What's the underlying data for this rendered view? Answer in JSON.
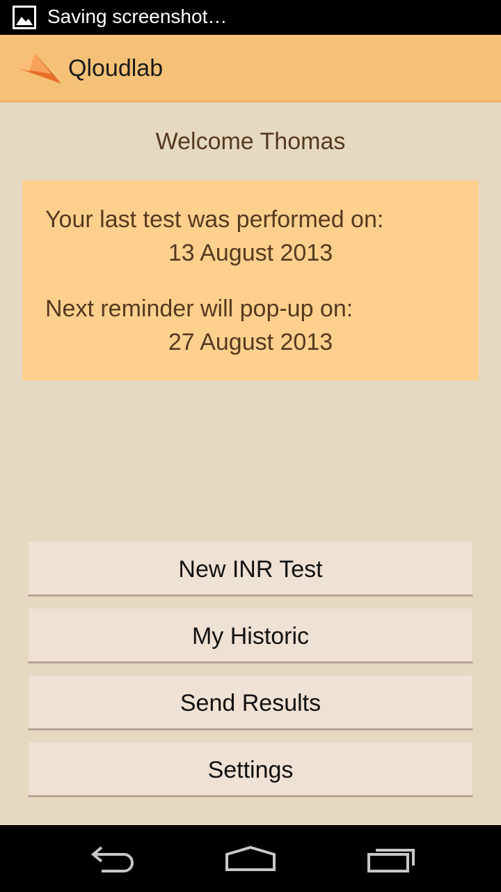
{
  "status_bar": {
    "notification_icon": "image-icon",
    "text": "Saving screenshot…"
  },
  "action_bar": {
    "logo": "qloudlab-logo",
    "title": "Qloudlab",
    "colors": {
      "background": "#f5c176"
    }
  },
  "main": {
    "welcome": "Welcome Thomas",
    "info": {
      "last_test_label": "Your last test was performed on:",
      "last_test_date": "13 August 2013",
      "next_reminder_label": "Next reminder will pop-up on:",
      "next_reminder_date": "27 August 2013"
    },
    "buttons": [
      {
        "label": "New INR Test"
      },
      {
        "label": "My Historic"
      },
      {
        "label": "Send Results"
      },
      {
        "label": "Settings"
      }
    ]
  },
  "nav_bar": {
    "icons": [
      "back-icon",
      "home-icon",
      "recent-apps-icon"
    ]
  },
  "colors": {
    "page_background": "#e6d9c2",
    "card_background": "#fdd08e",
    "text_brown": "#55391f",
    "button_background": "#efe1d4"
  }
}
